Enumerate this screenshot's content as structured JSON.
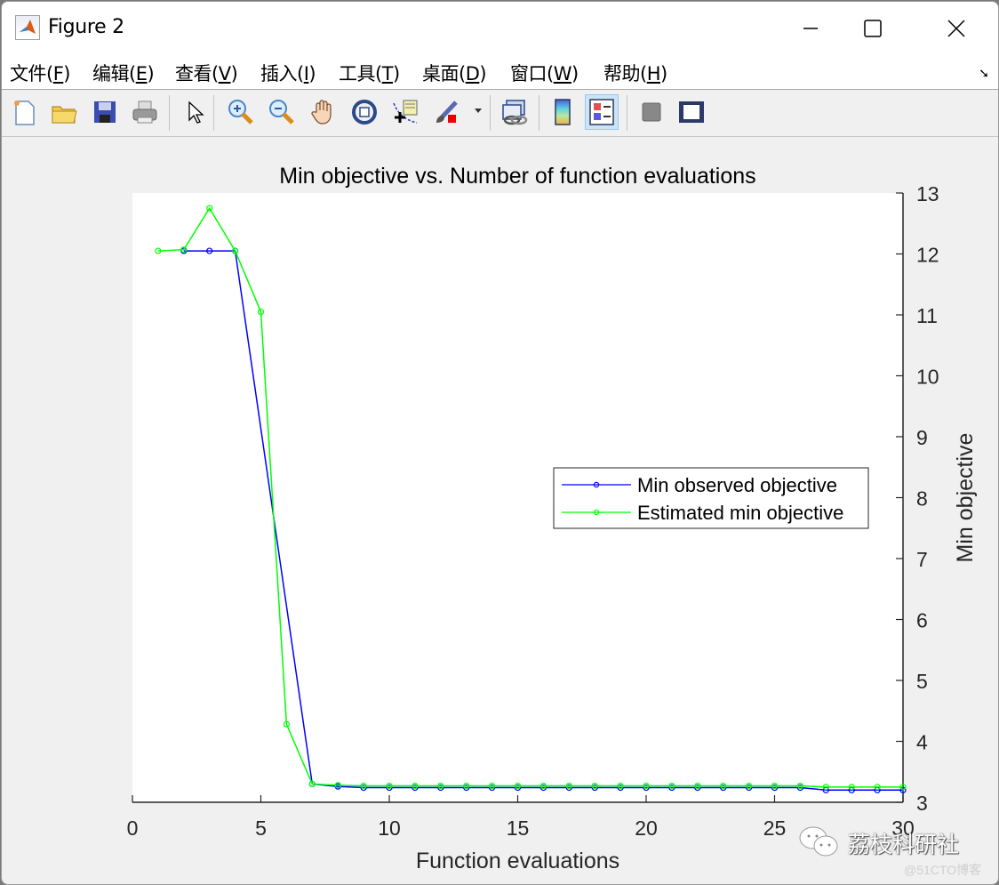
{
  "window": {
    "title": "Figure 2",
    "controls": {
      "minimize": "minimize-icon",
      "maximize": "maximize-icon",
      "close": "close-icon"
    }
  },
  "menu": [
    {
      "label": "文件(",
      "key": "F",
      "tail": ")"
    },
    {
      "label": "编辑(",
      "key": "E",
      "tail": ")"
    },
    {
      "label": "查看(",
      "key": "V",
      "tail": ")"
    },
    {
      "label": "插入(",
      "key": "I",
      "tail": ")"
    },
    {
      "label": "工具(",
      "key": "T",
      "tail": ")"
    },
    {
      "label": "桌面(",
      "key": "D",
      "tail": ")"
    },
    {
      "label": "窗口(",
      "key": "W",
      "tail": ")"
    },
    {
      "label": "帮助(",
      "key": "H",
      "tail": ")"
    }
  ],
  "toolbar": [
    "new-figure-icon",
    "open-file-icon",
    "save-icon",
    "print-icon",
    "select-arrow-icon",
    "zoom-in-icon",
    "zoom-out-icon",
    "pan-hand-icon",
    "rotate-3d-icon",
    "data-cursor-icon",
    "brush-icon",
    "link-plot-icon",
    "colorbar-icon",
    "legend-icon",
    "hide-plot-tools-icon",
    "show-plot-tools-icon"
  ],
  "watermark": {
    "text": "荔枝科研社",
    "sub": "@51CTO博客"
  },
  "chart_data": {
    "type": "line",
    "title": "Min objective vs. Number of function evaluations",
    "xlabel": "Function evaluations",
    "ylabel": "Min objective",
    "xlim": [
      0,
      30
    ],
    "ylim": [
      3,
      13
    ],
    "xticks": [
      0,
      5,
      10,
      15,
      20,
      25,
      30
    ],
    "yticks": [
      3,
      4,
      5,
      6,
      7,
      8,
      9,
      10,
      11,
      12,
      13
    ],
    "y_axis_location": "right",
    "grid": false,
    "legend": {
      "location": "right-center",
      "entries": [
        "Min observed objective",
        "Estimated min objective"
      ]
    },
    "x": [
      1,
      2,
      3,
      4,
      5,
      6,
      7,
      8,
      9,
      10,
      11,
      12,
      13,
      14,
      15,
      16,
      17,
      18,
      19,
      20,
      21,
      22,
      23,
      24,
      25,
      26,
      27,
      28,
      29,
      30
    ],
    "series": [
      {
        "name": "Min observed objective",
        "color": "#0000ff",
        "marker": "circle",
        "values": [
          null,
          12.05,
          12.05,
          12.05,
          null,
          null,
          3.3,
          3.26,
          3.24,
          3.24,
          3.24,
          3.24,
          3.24,
          3.24,
          3.24,
          3.24,
          3.24,
          3.24,
          3.24,
          3.24,
          3.24,
          3.24,
          3.24,
          3.24,
          3.24,
          3.24,
          3.2,
          3.2,
          3.2,
          3.2
        ]
      },
      {
        "name": "Estimated min objective",
        "color": "#00ff00",
        "marker": "circle",
        "values": [
          12.05,
          12.07,
          12.75,
          12.05,
          11.05,
          4.28,
          3.3,
          3.28,
          3.27,
          3.27,
          3.27,
          3.27,
          3.27,
          3.27,
          3.27,
          3.27,
          3.27,
          3.27,
          3.27,
          3.27,
          3.27,
          3.27,
          3.27,
          3.27,
          3.27,
          3.27,
          3.25,
          3.25,
          3.25,
          3.25
        ]
      }
    ]
  }
}
